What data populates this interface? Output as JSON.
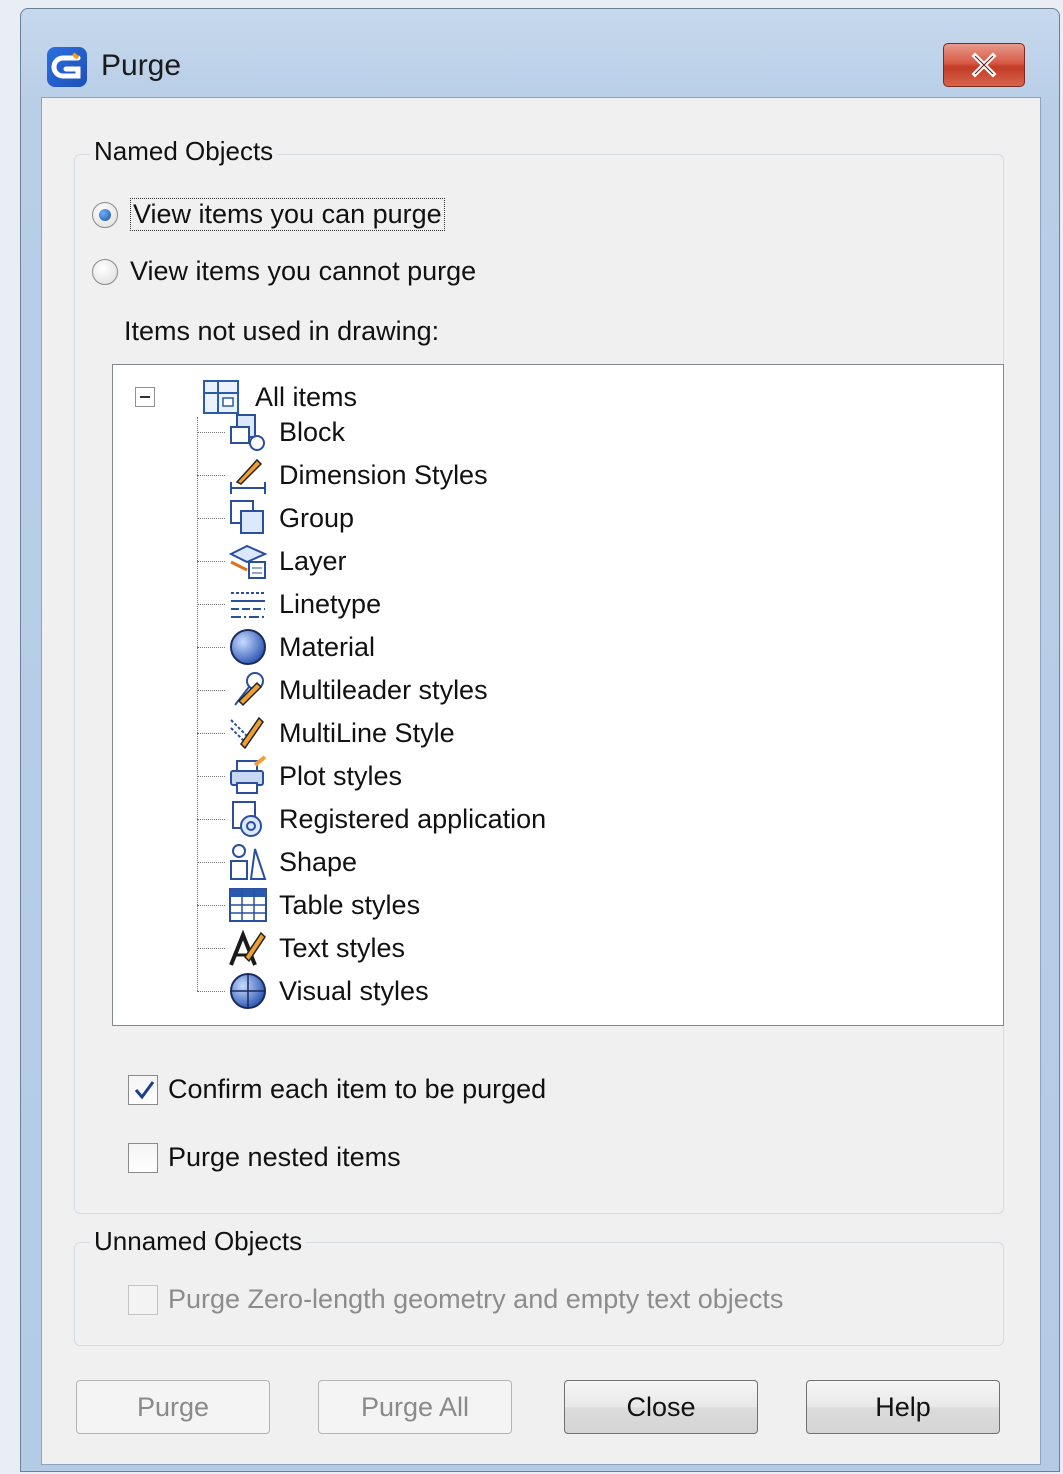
{
  "window": {
    "title": "Purge",
    "app_icon": "app-logo-icon",
    "close_icon": "close-x-icon"
  },
  "named_objects": {
    "label": "Named Objects",
    "radio_can_purge": {
      "label": "View items you can purge",
      "selected": true
    },
    "radio_cannot_purge": {
      "label": "View items you cannot purge",
      "selected": false
    },
    "items_label": "Items not used in drawing:",
    "tree": {
      "root": {
        "label": "All items",
        "expanded": true,
        "icon": "all-items-icon"
      },
      "items": [
        {
          "label": "Block",
          "icon": "block-icon"
        },
        {
          "label": "Dimension Styles",
          "icon": "dimension-styles-icon"
        },
        {
          "label": "Group",
          "icon": "group-icon"
        },
        {
          "label": "Layer",
          "icon": "layer-icon"
        },
        {
          "label": "Linetype",
          "icon": "linetype-icon"
        },
        {
          "label": "Material",
          "icon": "material-icon"
        },
        {
          "label": "Multileader styles",
          "icon": "multileader-styles-icon"
        },
        {
          "label": "MultiLine Style",
          "icon": "multiline-style-icon"
        },
        {
          "label": "Plot styles",
          "icon": "plot-styles-icon"
        },
        {
          "label": "Registered application",
          "icon": "registered-application-icon"
        },
        {
          "label": "Shape",
          "icon": "shape-icon"
        },
        {
          "label": "Table styles",
          "icon": "table-styles-icon"
        },
        {
          "label": "Text styles",
          "icon": "text-styles-icon"
        },
        {
          "label": "Visual styles",
          "icon": "visual-styles-icon"
        }
      ]
    },
    "confirm_each": {
      "label": "Confirm each item to be purged",
      "checked": true
    },
    "purge_nested": {
      "label": "Purge nested items",
      "checked": false
    }
  },
  "unnamed_objects": {
    "label": "Unnamed Objects",
    "purge_zero_length": {
      "label": "Purge Zero-length geometry and empty text objects",
      "checked": false,
      "enabled": false
    }
  },
  "buttons": {
    "purge": {
      "label": "Purge",
      "enabled": false
    },
    "purge_all": {
      "label": "Purge All",
      "enabled": false
    },
    "close": {
      "label": "Close",
      "enabled": true
    },
    "help": {
      "label": "Help",
      "enabled": true
    }
  }
}
